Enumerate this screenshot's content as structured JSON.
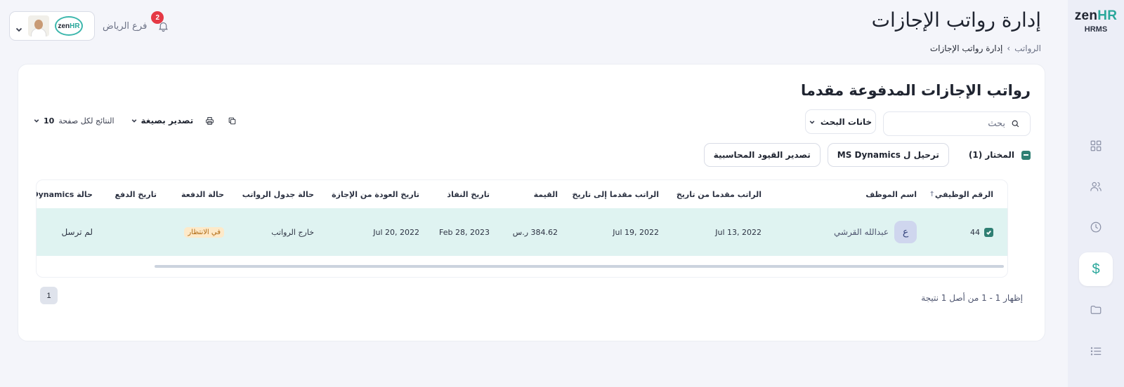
{
  "sidebar": {
    "brand": "zen",
    "brand_accent": "HR",
    "sub": "HRMS",
    "items": [
      {
        "icon": "dashboard-grid-icon"
      },
      {
        "icon": "users-icon"
      },
      {
        "icon": "clock-icon"
      },
      {
        "icon": "dollar-icon",
        "active": true,
        "glyph": "$"
      },
      {
        "icon": "folder-icon"
      },
      {
        "icon": "list-icon"
      }
    ]
  },
  "header": {
    "title": "إدارة رواتب الإجازات",
    "breadcrumb": {
      "root": "الرواتب",
      "current": "إدارة رواتب الإجازات"
    },
    "branch": "فرع الرياض",
    "notifications": "2",
    "company_logo": "zen",
    "company_logo_accent": "HR"
  },
  "card": {
    "title": "رواتب الإجازات المدفوعة مقدما",
    "search_placeholder": "بحث",
    "search_fields_label": "خانات البحث",
    "per_page_label": "النتائج لكل صفحة",
    "per_page_value": "10",
    "export_label": "تصدير بصيغة",
    "selected_label": "المختار (1)",
    "post_button": "ترحيل ل MS Dynamics",
    "export_entries_button": "تصدير القيود المحاسبية"
  },
  "table": {
    "columns": [
      "الرقم الوظيفي",
      "اسم الموظف",
      "الراتب مقدما من تاريخ",
      "الراتب مقدما إلى تاريخ",
      "القيمة",
      "تاريخ النفاذ",
      "تاريخ العودة من الإجازة",
      "حالة جدول الرواتب",
      "حالة الدفعة",
      "تاريخ الدفع",
      "حالة Dynamics"
    ],
    "rows": [
      {
        "id": "44",
        "avatar_letter": "ع",
        "name": "عبدالله القرشي",
        "from_date": "Jul 13, 2022",
        "to_date": "Jul 19, 2022",
        "amount": "384.62 ر.س",
        "effective_date": "Feb 28, 2023",
        "return_date": "Jul 20, 2022",
        "payroll_status": "خارج الرواتب",
        "payment_status": "في الانتظار",
        "payment_date": "",
        "dynamics_status": "لم ترسل"
      }
    ]
  },
  "footer": {
    "page": "1",
    "showing": "إظهار 1 - 1 من أصل 1 نتيجة"
  },
  "colors": {
    "accent": "#2aa79b",
    "selected_row": "#dff3f1",
    "checkbox": "#2f7f73",
    "badge": "#e53945",
    "pending_bg": "#fde9c9"
  }
}
